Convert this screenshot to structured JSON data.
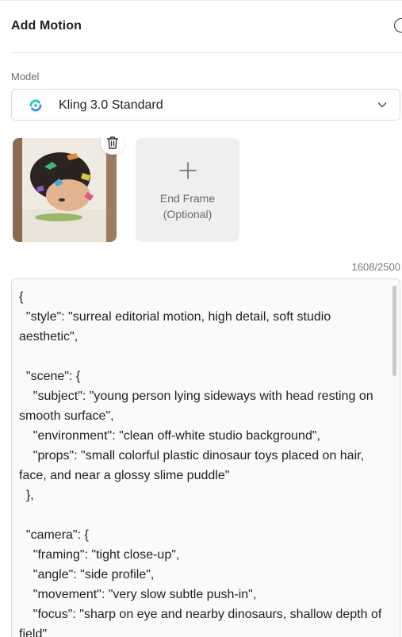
{
  "header": {
    "title": "Add Motion",
    "help_icon": "help-circle-icon"
  },
  "model": {
    "label": "Model",
    "selected": "Kling 3.0 Standard",
    "icon": "kling-logo-icon",
    "dropdown_icon": "chevron-down-icon"
  },
  "frames": {
    "start": {
      "image": "portrait-with-dinosaur-toys",
      "delete_icon": "trash-icon"
    },
    "end": {
      "icon": "plus-icon",
      "label": "End Frame\n(Optional)"
    }
  },
  "prompt": {
    "char_count": "1608/2500",
    "text": "{\n  \"style\": \"surreal editorial motion, high detail, soft studio aesthetic\",\n\n  \"scene\": {\n    \"subject\": \"young person lying sideways with head resting on smooth surface\",\n    \"environment\": \"clean off-white studio background\",\n    \"props\": \"small colorful plastic dinosaur toys placed on hair, face, and near a glossy slime puddle\"\n  },\n\n  \"camera\": {\n    \"framing\": \"tight close-up\",\n    \"angle\": \"side profile\",\n    \"movement\": \"very slow subtle push-in\",\n    \"focus\": \"sharp on eye and nearby dinosaurs, shallow depth of field\"\n  },"
  },
  "colors": {
    "accent_gradient": [
      "#35c2c9",
      "#4d8df7",
      "#46d38b"
    ],
    "border": "#dadada",
    "muted_text": "#6b6b6b"
  }
}
